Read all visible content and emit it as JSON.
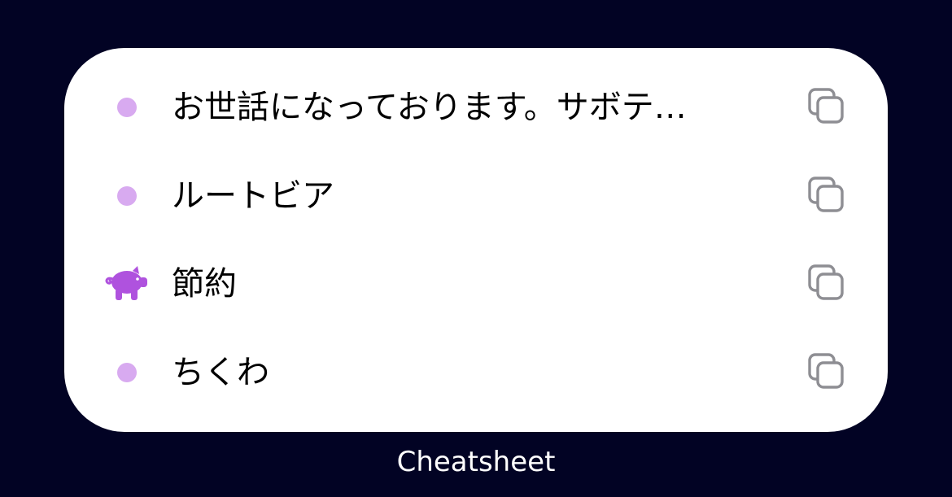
{
  "widget": {
    "items": [
      {
        "label": "お世話になっております。サボテ…",
        "leading": "dot",
        "leading_color": "#D8AAF0",
        "action_icon": "copy-icon"
      },
      {
        "label": "ルートビア",
        "leading": "dot",
        "leading_color": "#D8AAF0",
        "action_icon": "copy-icon"
      },
      {
        "label": "節約",
        "leading": "pig-icon",
        "leading_color": "#AF52DE",
        "action_icon": "copy-icon"
      },
      {
        "label": "ちくわ",
        "leading": "dot",
        "leading_color": "#D8AAF0",
        "action_icon": "copy-icon"
      }
    ]
  },
  "caption": "Cheatsheet",
  "colors": {
    "background": "#020324",
    "widget_background": "#FFFFFF",
    "dot": "#D8AAF0",
    "pig": "#AF52DE",
    "copy_icon": "#8E8E93",
    "caption": "#FFFFFF"
  }
}
